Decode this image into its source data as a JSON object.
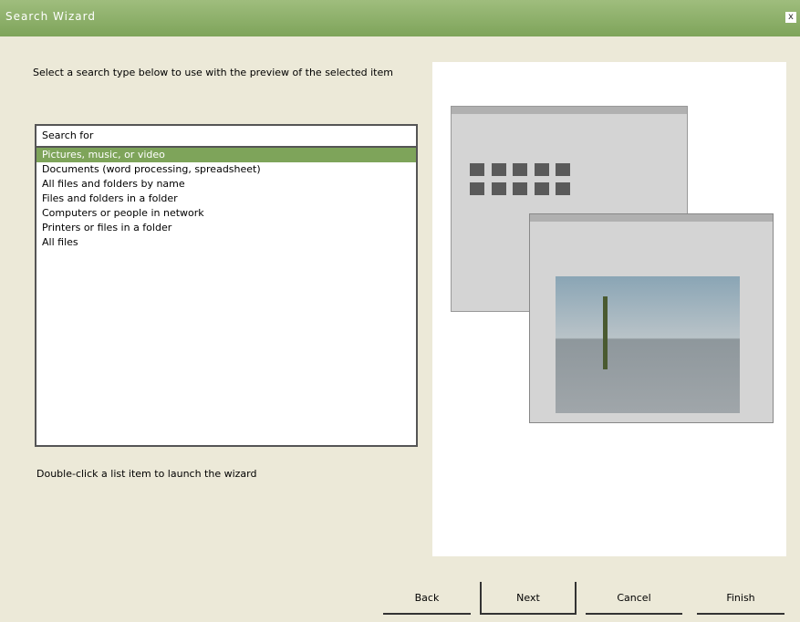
{
  "window": {
    "title": "Search Wizard",
    "close_label": "x"
  },
  "intro_text": "Select a search type below to use with the preview of the selected item",
  "list": {
    "header": "Search for",
    "items": [
      "Pictures, music, or video",
      "Documents (word processing, spreadsheet)",
      "All files and folders by name",
      "Files and folders in a folder",
      "Computers or people in network",
      "Printers or files in a folder",
      "All files"
    ],
    "selected_index": 0
  },
  "status_text": "Double-click a list item to launch the wizard",
  "buttons": {
    "back": "Back",
    "next": "Next",
    "cancel": "Cancel",
    "finish": "Finish"
  },
  "colors": {
    "accent": "#7ea45a",
    "background": "#ece9d8"
  }
}
